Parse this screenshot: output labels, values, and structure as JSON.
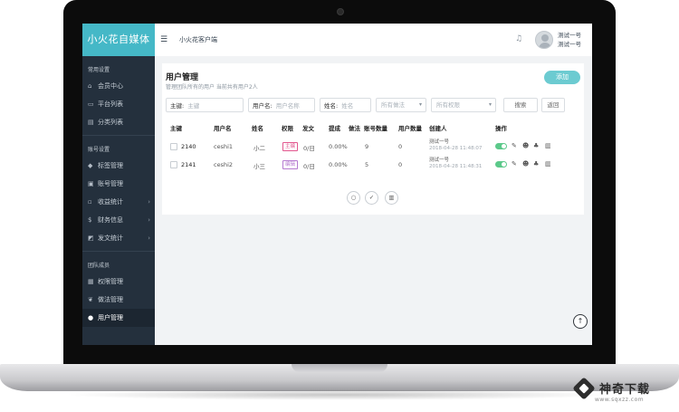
{
  "sidebar": {
    "brand": "小火花自媒体",
    "sections": [
      {
        "title": "常用设置",
        "items": [
          {
            "label": "会员中心",
            "icon": "home-icon"
          },
          {
            "label": "平台列表",
            "icon": "monitor-icon"
          },
          {
            "label": "分类列表",
            "icon": "list-icon"
          }
        ]
      },
      {
        "title": "账号设置",
        "items": [
          {
            "label": "标签管理",
            "icon": "tag-icon"
          },
          {
            "label": "账号管理",
            "icon": "account-icon"
          },
          {
            "label": "收益统计",
            "icon": "money-icon",
            "chevron": "›"
          },
          {
            "label": "财务信息",
            "icon": "dollar-icon",
            "chevron": "›"
          },
          {
            "label": "发文统计",
            "icon": "chart-icon",
            "chevron": "›"
          }
        ]
      },
      {
        "title": "团队成员",
        "items": [
          {
            "label": "权限管理",
            "icon": "briefcase-icon"
          },
          {
            "label": "做法管理",
            "icon": "leaf-icon"
          },
          {
            "label": "用户管理",
            "icon": "user-icon",
            "active": true
          }
        ]
      }
    ]
  },
  "topbar": {
    "title": "小火花客户端",
    "user_line1": "测试一号",
    "user_line2": "测试一号"
  },
  "panel": {
    "title": "用户管理",
    "subtitle": "管理团队所有的用户  当前共有用户2人",
    "add_label": "添加"
  },
  "filters": {
    "key_label": "主键:",
    "key_placeholder": "主键",
    "username_label": "用户名:",
    "username_placeholder": "用户名称",
    "name_label": "姓名:",
    "name_placeholder": "姓名",
    "method_placeholder": "所有做法",
    "perm_placeholder": "所有权限",
    "search_label": "搜索",
    "back_label": "返回"
  },
  "table": {
    "headers": [
      "主键",
      "用户名",
      "姓名",
      "权限",
      "发文",
      "提成",
      "做法",
      "账号数量",
      "用户数量",
      "创建人",
      "操作"
    ],
    "rows": [
      {
        "id": "2140",
        "username": "ceshi1",
        "name": "小二",
        "role": "主编",
        "role_color": "#e2568e",
        "posts": "0/日",
        "commission": "0.00%",
        "accounts": "9",
        "users": "0",
        "creator": "测试一号",
        "created": "2018-04-28 11:48:07"
      },
      {
        "id": "2141",
        "username": "ceshi2",
        "name": "小三",
        "role": "编辑",
        "role_color": "#b57ad0",
        "posts": "0/日",
        "commission": "0.00%",
        "accounts": "5",
        "users": "0",
        "creator": "测试一号",
        "created": "2018-04-28 11:48:31"
      }
    ]
  },
  "watermark": {
    "text": "神奇下载",
    "url": "www.sqxzz.com"
  }
}
